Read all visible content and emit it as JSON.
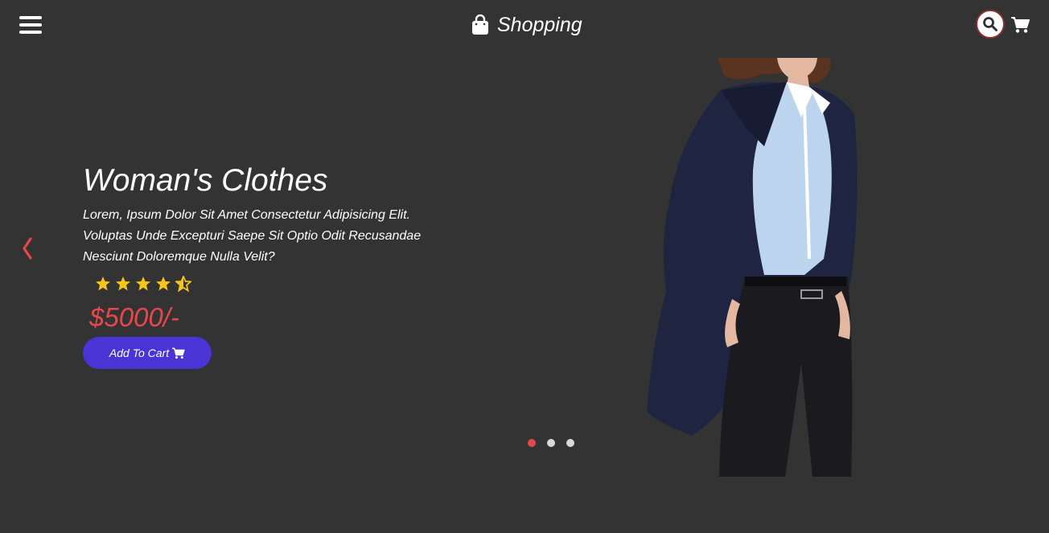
{
  "navbar": {
    "menu_icon": "hamburger-menu-icon",
    "brand": {
      "icon": "shopping-bag-icon",
      "title": "Shopping"
    },
    "search_icon": "search-icon",
    "cart_icon": "cart-icon"
  },
  "slider": {
    "prev_icon": "chevron-left-icon",
    "title": "Woman's Clothes",
    "description": "Lorem, Ipsum Dolor Sit Amet Consectetur Adipisicing Elit. Voluptas Unde Excepturi Saepe Sit Optio Odit Recusandae Nesciunt Doloremque Nulla Velit?",
    "rating": 4.5,
    "rating_max": 5,
    "price": "$5000/-",
    "add_to_cart_label": "Add To Cart",
    "add_to_cart_icon": "cart-icon",
    "dots": [
      {
        "active": true
      },
      {
        "active": false
      },
      {
        "active": false
      }
    ]
  },
  "colors": {
    "background": "#333333",
    "accent": "#e8474a",
    "button": "#4a34d6",
    "star": "#f5c518"
  }
}
